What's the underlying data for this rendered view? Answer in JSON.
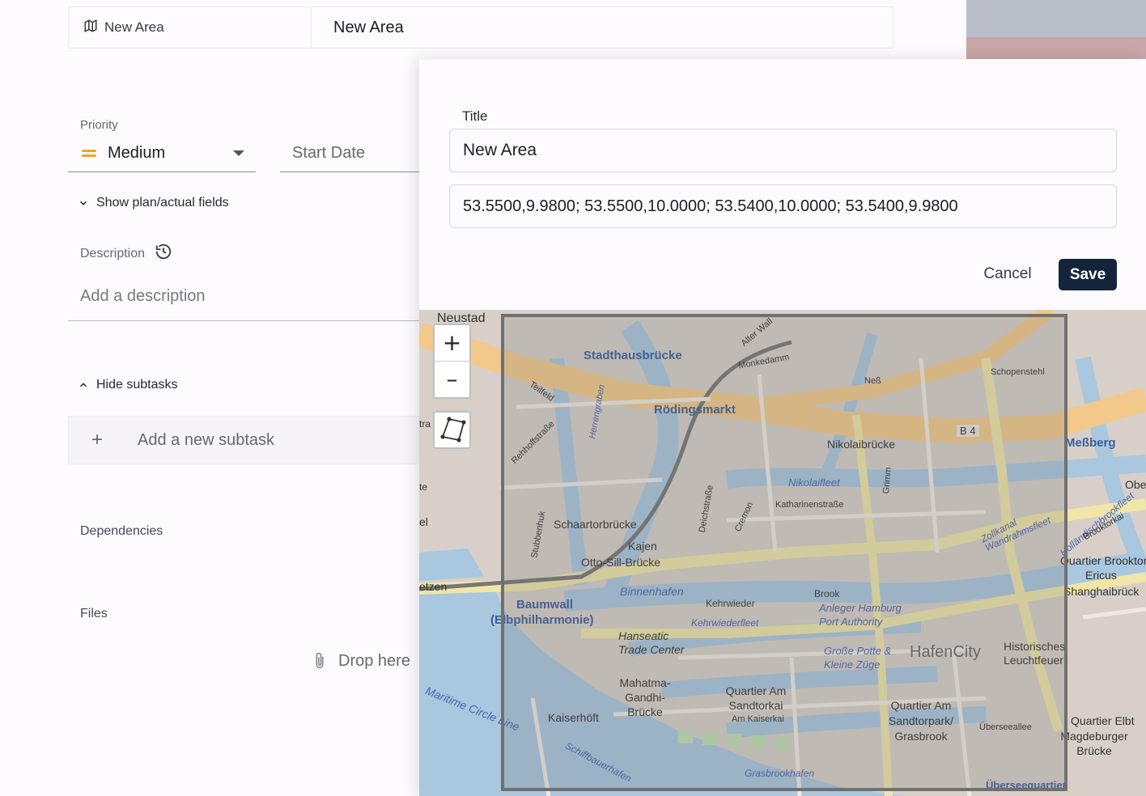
{
  "task": {
    "area_row": {
      "label": "New Area",
      "value": "New Area"
    },
    "priority": {
      "label": "Priority",
      "value": "Medium"
    },
    "start_date": {
      "placeholder": "Start Date"
    },
    "plan_toggle": "Show plan/actual fields",
    "description": {
      "label": "Description",
      "placeholder": "Add a description"
    },
    "subtasks_toggle": "Hide subtasks",
    "add_subtask": "Add a new subtask",
    "dependencies_label": "Dependencies",
    "files_label": "Files",
    "drop_text": "Drop here"
  },
  "dialog": {
    "title_label": "Title",
    "title_value": "New Area",
    "coordinates_value": "53.5500,9.9800; 53.5500,10.0000; 53.5400,10.0000; 53.5400,9.9800",
    "cancel_label": "Cancel",
    "save_label": "Save"
  },
  "map": {
    "zoom_in": "+",
    "zoom_out": "–",
    "labels": [
      "Neustad",
      "Stadthausbrücke",
      "Rödingsmarkt",
      "Nikolaibrücke",
      "Meßberg",
      "Obe",
      "Schaartorbrücke",
      "Otto-Sill-Brücke",
      "Baumwall",
      "(Elbphilharmonie)",
      "Kajen",
      "Binnenhafen",
      "Kehrwieder",
      "Brook",
      "Anleger Hamburg Port Authority",
      "Große Potte & Kleine Züge",
      "HafenCity",
      "Historisches Leuchtfeuer",
      "Quartier Brooktor",
      "Ericus",
      "Shanghaibrück",
      "Hanseatic Trade Center",
      "Mahatma-Gandhi-Brücke",
      "Quartier Am Sandtorkai",
      "Am Kaiserkai",
      "Quartier Am Sandtorpark/ Grasbrook",
      "Kaiserhöft",
      "Überseeallee",
      "Magdeburger Brücke",
      "Quartier Elbt",
      "Maritime Circle Line",
      "Schiffbauerhafen",
      "Grasbrookhafen",
      "Katharinenstraße",
      "Nikolaifleet",
      "Zollkanal",
      "Wandrahmsfleet",
      "Schopenstehl",
      "Neß",
      "Teilfeld",
      "Rehhoffstraße",
      "Herrengraben",
      "Stubbenhuk",
      "Deichstraße",
      "Cremon",
      "Grimm",
      "Kehrwiederfleet",
      "Monkedamm",
      "Alter Wall",
      "B 4",
      "Überseequartier",
      "Holländischbrookfleet",
      "Brooktorkai",
      "etzen",
      "el",
      "tra",
      "te"
    ]
  },
  "colors": {
    "save_bg": "#14243a",
    "priority_icon": "#f0a51f",
    "selection_border": "#707070"
  },
  "icons": [
    "map-icon",
    "history-icon",
    "chevron-down-icon",
    "chevron-up-icon",
    "plus-icon",
    "paperclip-icon",
    "polygon-draw-icon"
  ]
}
